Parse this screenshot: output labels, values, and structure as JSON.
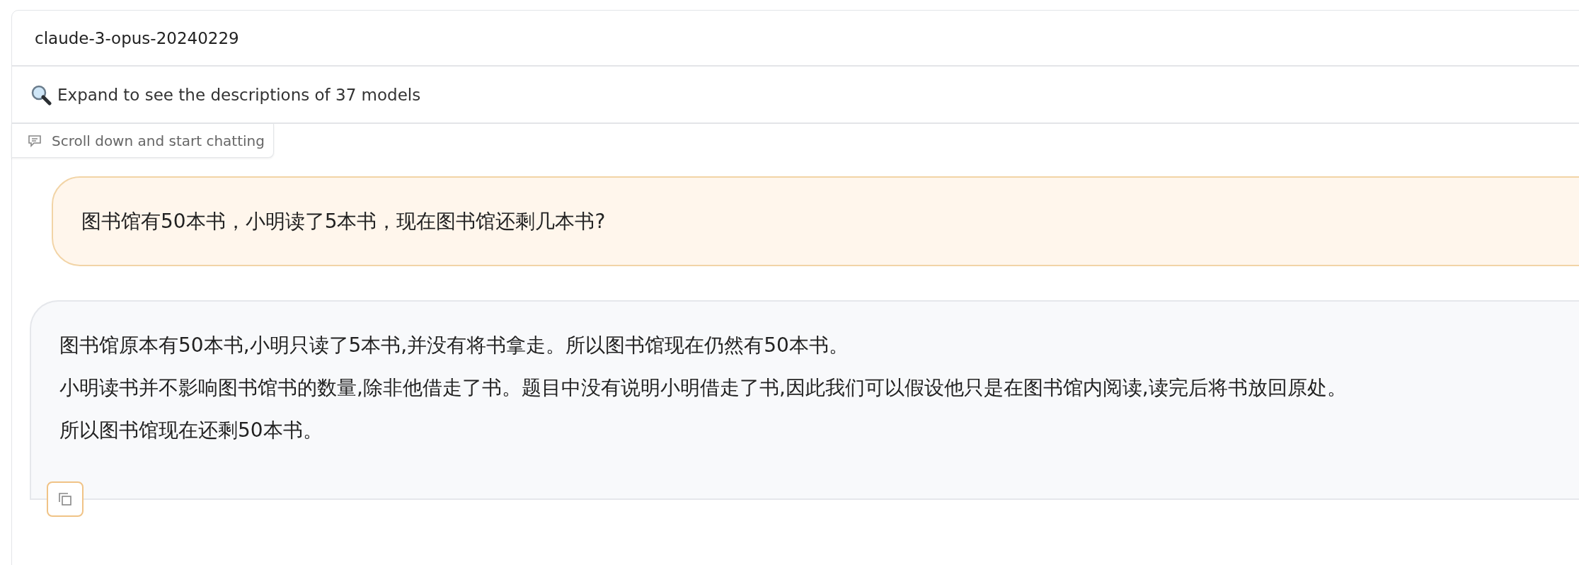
{
  "model_selector": {
    "value": "claude-3-opus-20240229"
  },
  "models_accordion": {
    "label": "Expand to see the descriptions of 37 models",
    "expanded": false
  },
  "chatbot": {
    "label": "Scroll down and start chatting",
    "messages": [
      {
        "kind": "user",
        "paragraphs": [
          "图书馆有50本书，小明读了5本书，现在图书馆还剩几本书?"
        ]
      },
      {
        "kind": "assistant",
        "paragraphs": [
          "图书馆原本有50本书,小明只读了5本书,并没有将书拿走。所以图书馆现在仍然有50本书。",
          "小明读书并不影响图书馆书的数量,除非他借走了书。题目中没有说明小明借走了书,因此我们可以假设他只是在图书馆内阅读,读完后将书放回原处。",
          "所以图书馆现在还剩50本书。"
        ]
      }
    ]
  }
}
